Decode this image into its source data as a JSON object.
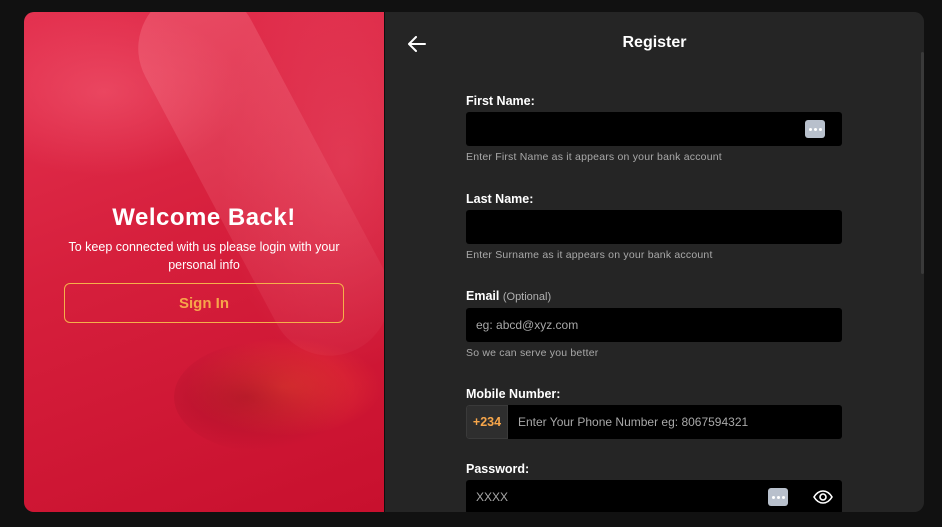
{
  "left_panel": {
    "title": "Welcome Back!",
    "text": "To keep connected with us please login with your personal info",
    "signin_label": "Sign In"
  },
  "register": {
    "title": "Register",
    "first_name": {
      "label": "First Name:",
      "value": "",
      "hint": "Enter First Name as it appears on your bank account"
    },
    "last_name": {
      "label": "Last Name:",
      "value": "",
      "hint": "Enter Surname as it appears on your bank account"
    },
    "email": {
      "label": "Email",
      "optional": "(Optional)",
      "placeholder": "eg: abcd@xyz.com",
      "hint": "So we can serve you better"
    },
    "mobile": {
      "label": "Mobile Number:",
      "code": "+234",
      "placeholder": "Enter Your Phone Number eg: 8067594321"
    },
    "password": {
      "label": "Password:",
      "placeholder": "XXXX"
    }
  },
  "icons": {
    "back": "arrow-left-icon",
    "password_manager": "password-manager-icon",
    "show_password": "eye-icon"
  },
  "colors": {
    "accent": "#f7a64a",
    "panel_red": "#d61f3c",
    "background": "#252525",
    "input": "#000000"
  }
}
